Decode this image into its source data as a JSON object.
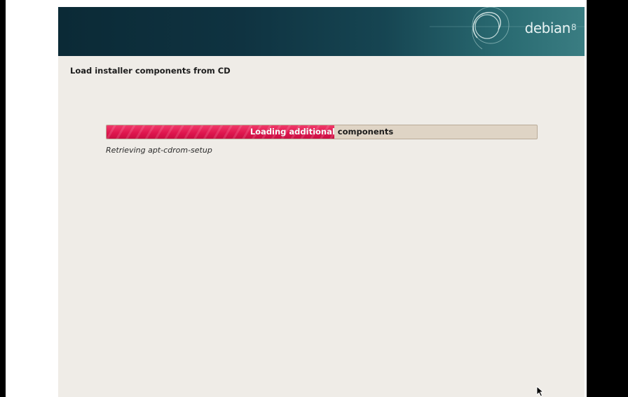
{
  "banner": {
    "brand_name": "debian",
    "brand_version": "8"
  },
  "page": {
    "title": "Load installer components from CD"
  },
  "progress": {
    "label": "Loading additional components",
    "fraction": 0.529,
    "fill_color": "#e0174f",
    "track_color": "#dfd4c5"
  },
  "status": {
    "message": "Retrieving apt-cdrom-setup"
  },
  "icons": {
    "logo": "debian-swirl-logo",
    "pointer": "mouse-pointer-icon"
  },
  "colors": {
    "banner_dark": "#0b2a36",
    "banner_light": "#3a7d82",
    "window_background": "#efece7"
  }
}
